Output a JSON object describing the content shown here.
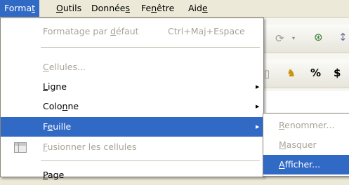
{
  "menubar": {
    "items": [
      {
        "pre": "Forma",
        "u": "t",
        "post": ""
      },
      {
        "pre": "",
        "u": "O",
        "post": "utils"
      },
      {
        "pre": "Donnée",
        "u": "s",
        "post": ""
      },
      {
        "pre": "Fe",
        "u": "n",
        "post": "être"
      },
      {
        "pre": "Aid",
        "u": "e",
        "post": ""
      }
    ]
  },
  "format_menu": {
    "items": [
      {
        "pre": "Formatage par ",
        "u": "d",
        "post": "éfaut",
        "shortcut": "Ctrl+Maj+Espace",
        "state": "disabled"
      },
      {
        "pre": "",
        "u": "C",
        "post": "ellules...",
        "state": "disabled"
      },
      {
        "pre": "",
        "u": "L",
        "post": "igne",
        "state": "normal",
        "submenu": true
      },
      {
        "pre": "Colo",
        "u": "n",
        "post": "ne",
        "state": "normal",
        "submenu": true
      },
      {
        "pre": "F",
        "u": "e",
        "post": "uille",
        "state": "highlighted",
        "submenu": true
      },
      {
        "pre": "",
        "u": "F",
        "post": "usionner les cellules",
        "state": "disabled",
        "icon": "merge-cells-icon"
      },
      {
        "pre": "",
        "u": "P",
        "post": "age",
        "state": "normal"
      }
    ]
  },
  "sheet_submenu": {
    "items": [
      {
        "pre": "",
        "u": "R",
        "post": "enommer...",
        "state": "disabled"
      },
      {
        "pre": "",
        "u": "M",
        "post": "asquer",
        "state": "disabled"
      },
      {
        "pre": "",
        "u": "A",
        "post": "fficher...",
        "state": "highlighted"
      }
    ]
  },
  "toolbar": {
    "icons": [
      "redo-icon",
      "dropdown-arrow-icon",
      "binoculars-icon",
      "sort-icon",
      "cut-icon",
      "highlight-icon",
      "percent-icon",
      "currency-icon"
    ],
    "percent_label": "%",
    "currency_label": "$"
  },
  "colors": {
    "highlight": "#316ac5",
    "menubar": "#ece9d8",
    "disabled_text": "#a8a497"
  }
}
